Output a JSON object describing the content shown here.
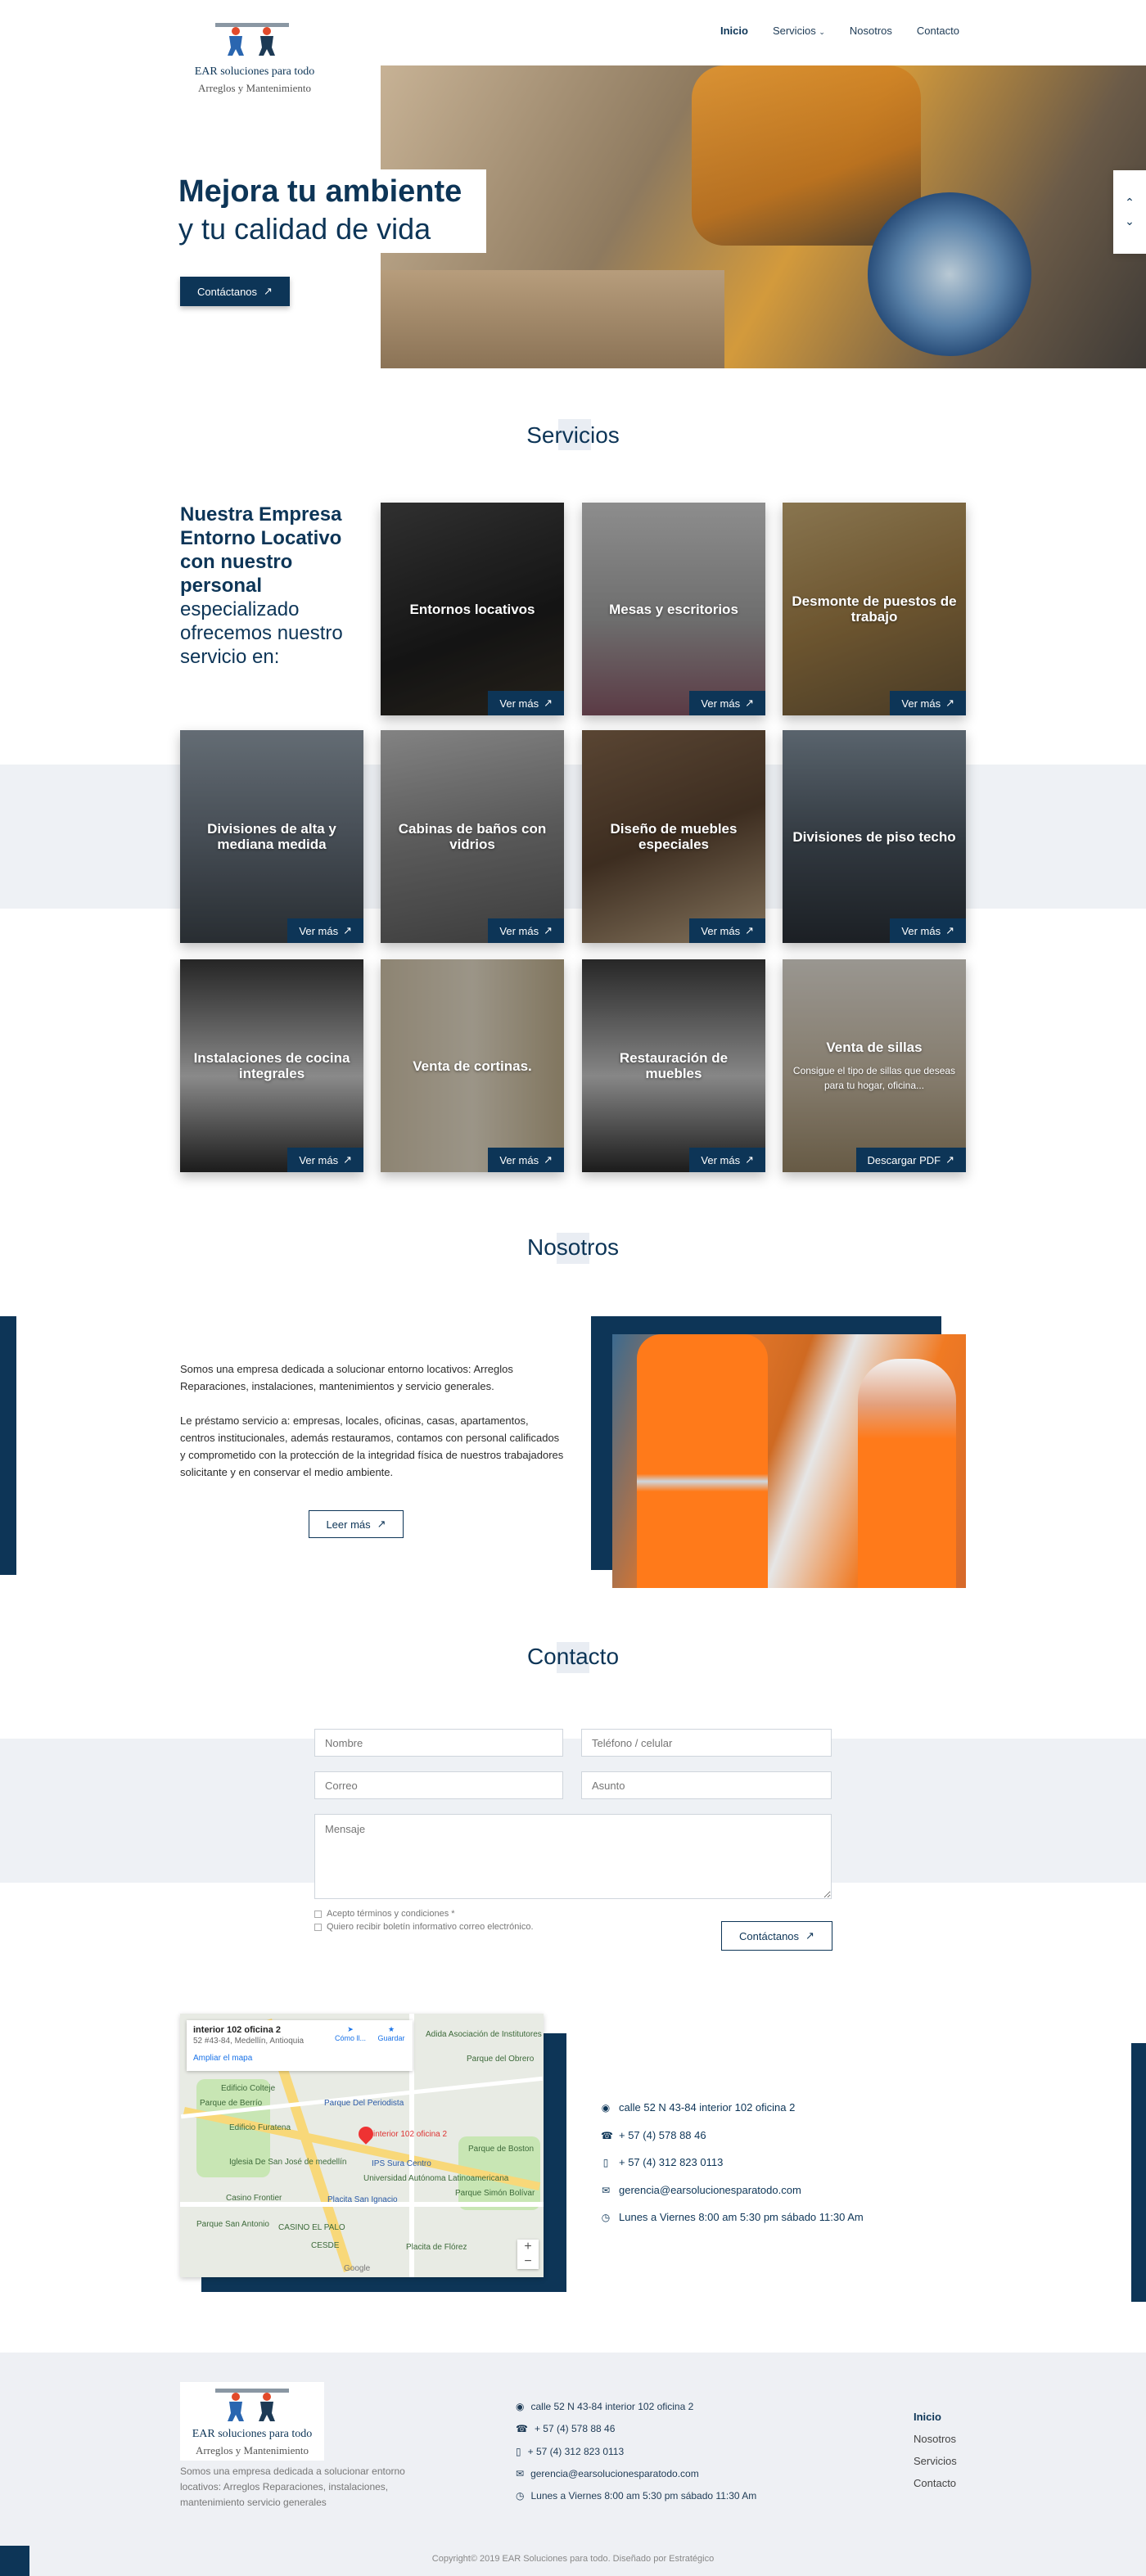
{
  "brand": {
    "title": "EAR soluciones para todo",
    "subtitle": "Arreglos y Mantenimiento"
  },
  "nav": {
    "items": [
      "Inicio",
      "Servicios",
      "Nosotros",
      "Contacto"
    ],
    "active": "Inicio"
  },
  "hero": {
    "line1": "Mejora tu ambiente",
    "line2": "y tu calidad de vida",
    "cta": "Contáctanos"
  },
  "services": {
    "title": "Servicios",
    "intro_bold": "Nuestra Empresa Entorno Locativo con nuestro personal",
    "intro_rest": "especializado ofrecemos nuestro servicio en:",
    "cards": [
      {
        "title": "Entornos locativos",
        "cta": "Ver más"
      },
      {
        "title": "Mesas y escritorios",
        "cta": "Ver más"
      },
      {
        "title": "Desmonte de puestos de trabajo",
        "cta": "Ver más"
      },
      {
        "title": "Divisiones de alta y mediana medida",
        "cta": "Ver más"
      },
      {
        "title": "Cabinas de baños con vidrios",
        "cta": "Ver más"
      },
      {
        "title": "Diseño de muebles especiales",
        "cta": "Ver más"
      },
      {
        "title": "Divisiones de piso techo",
        "cta": "Ver más"
      },
      {
        "title": "Instalaciones de cocina integrales",
        "cta": "Ver más"
      },
      {
        "title": "Venta de cortinas.",
        "cta": "Ver más"
      },
      {
        "title": "Restauración de muebles",
        "cta": "Ver más"
      },
      {
        "title": "Venta de sillas",
        "desc": "Consigue el tipo de sillas que deseas para tu hogar, oficina...",
        "cta": "Descargar PDF"
      }
    ]
  },
  "about": {
    "title": "Nosotros",
    "p1": "Somos una empresa dedicada a solucionar entorno locativos: Arreglos Reparaciones, instalaciones, mantenimientos y servicio generales.",
    "p2": "Le préstamo servicio a: empresas, locales, oficinas, casas, apartamentos, centros institucionales, además restauramos, contamos con personal calificados y comprometido con la protección de la integridad física de nuestros trabajadores solicitante y  en conservar  el medio ambiente.",
    "cta": "Leer más"
  },
  "contact": {
    "title": "Contacto",
    "name_placeholder": "Nombre",
    "phone_placeholder": "Teléfono / celular",
    "email_placeholder": "Correo",
    "subject_placeholder": "Asunto",
    "message_placeholder": "Mensaje",
    "terms": "Acepto términos y condiciones *",
    "newsletter": "Quiero recibir boletín informativo correo electrónico.",
    "submit": "Contáctanos"
  },
  "map": {
    "place": "interior 102 oficina 2",
    "address": "52 #43-84, Medellín, Antioquia",
    "enlarge": "Ampliar el mapa",
    "directions": "Cómo ll...",
    "save": "Guardar",
    "marker_label": "interior 102 oficina 2",
    "labels": [
      "Adida Asociación de Institutores de Antioquia",
      "Edificio Colteje",
      "Parque del Obrero",
      "Parque de Berrío",
      "Parque Del Periodista",
      "Edificio Furatena",
      "Parque de Boston",
      "Iglesia De San José de medellín",
      "IPS Sura Centro",
      "Universidad Autónoma Latinoamericana",
      "Casino Frontier",
      "Placita San Ignacio",
      "Parque Simón Bolívar",
      "Parque San Antonio",
      "CASINO EL PALO",
      "CESDE",
      "Placita de Flórez",
      "Google"
    ]
  },
  "info": {
    "address": "calle 52 N 43-84 interior 102 oficina 2",
    "phone": "+ 57 (4) 578 88 46",
    "mobile": "+ 57 (4) 312 823 0113",
    "email": "gerencia@earsolucionesparatodo.com",
    "hours": "Lunes a Viernes  8:00 am 5:30 pm  sábado 11:30 Am"
  },
  "footer": {
    "description": "Somos una empresa dedicada a solucionar entorno locativos: Arreglos Reparaciones, instalaciones, mantenimiento servicio generales",
    "nav": [
      "Inicio",
      "Nosotros",
      "Servicios",
      "Contacto"
    ],
    "copyright": "Copyright© 2019 EAR Soluciones para todo. Diseñado por Estratégico"
  },
  "colors": {
    "primary": "#0d3557",
    "band": "#eef1f5",
    "accent_orange": "#e8972c"
  }
}
